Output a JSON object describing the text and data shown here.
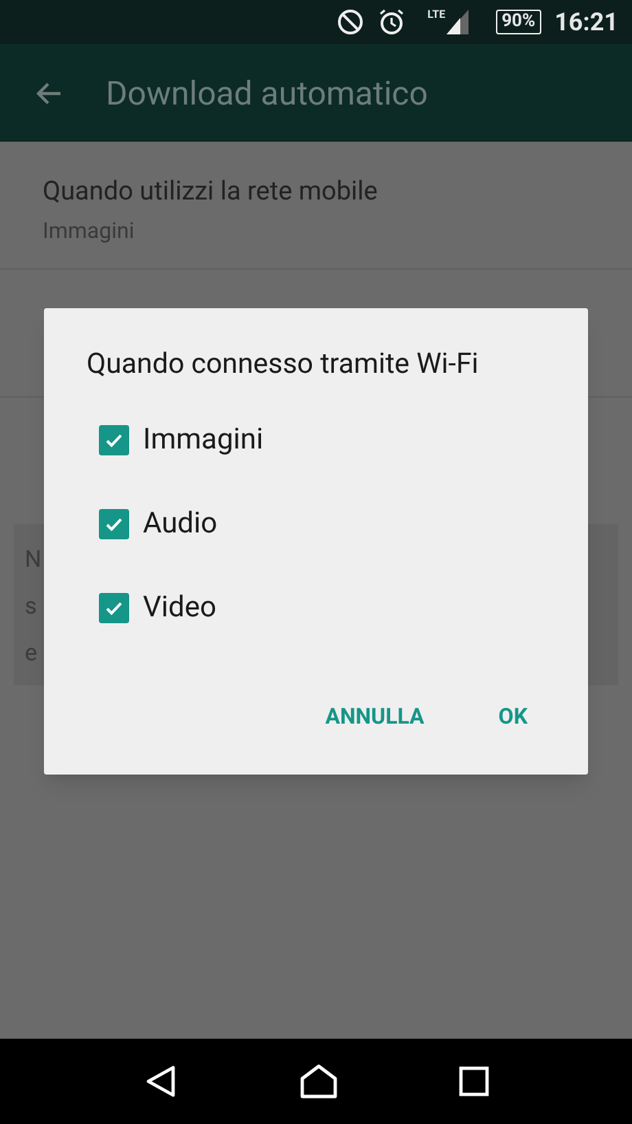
{
  "status_bar": {
    "network": "LTE",
    "battery": "90%",
    "time": "16:21"
  },
  "toolbar": {
    "title": "Download automatico"
  },
  "settings": [
    {
      "title": "Quando utilizzi la rete mobile",
      "subtitle": "Immagini"
    }
  ],
  "note": {
    "lines": [
      "N",
      "s",
      "e"
    ]
  },
  "dialog": {
    "title": "Quando connesso tramite Wi-Fi",
    "options": [
      {
        "label": "Immagini",
        "checked": true
      },
      {
        "label": "Audio",
        "checked": true
      },
      {
        "label": "Video",
        "checked": true
      }
    ],
    "buttons": [
      "ANNULLA",
      "OK"
    ]
  }
}
